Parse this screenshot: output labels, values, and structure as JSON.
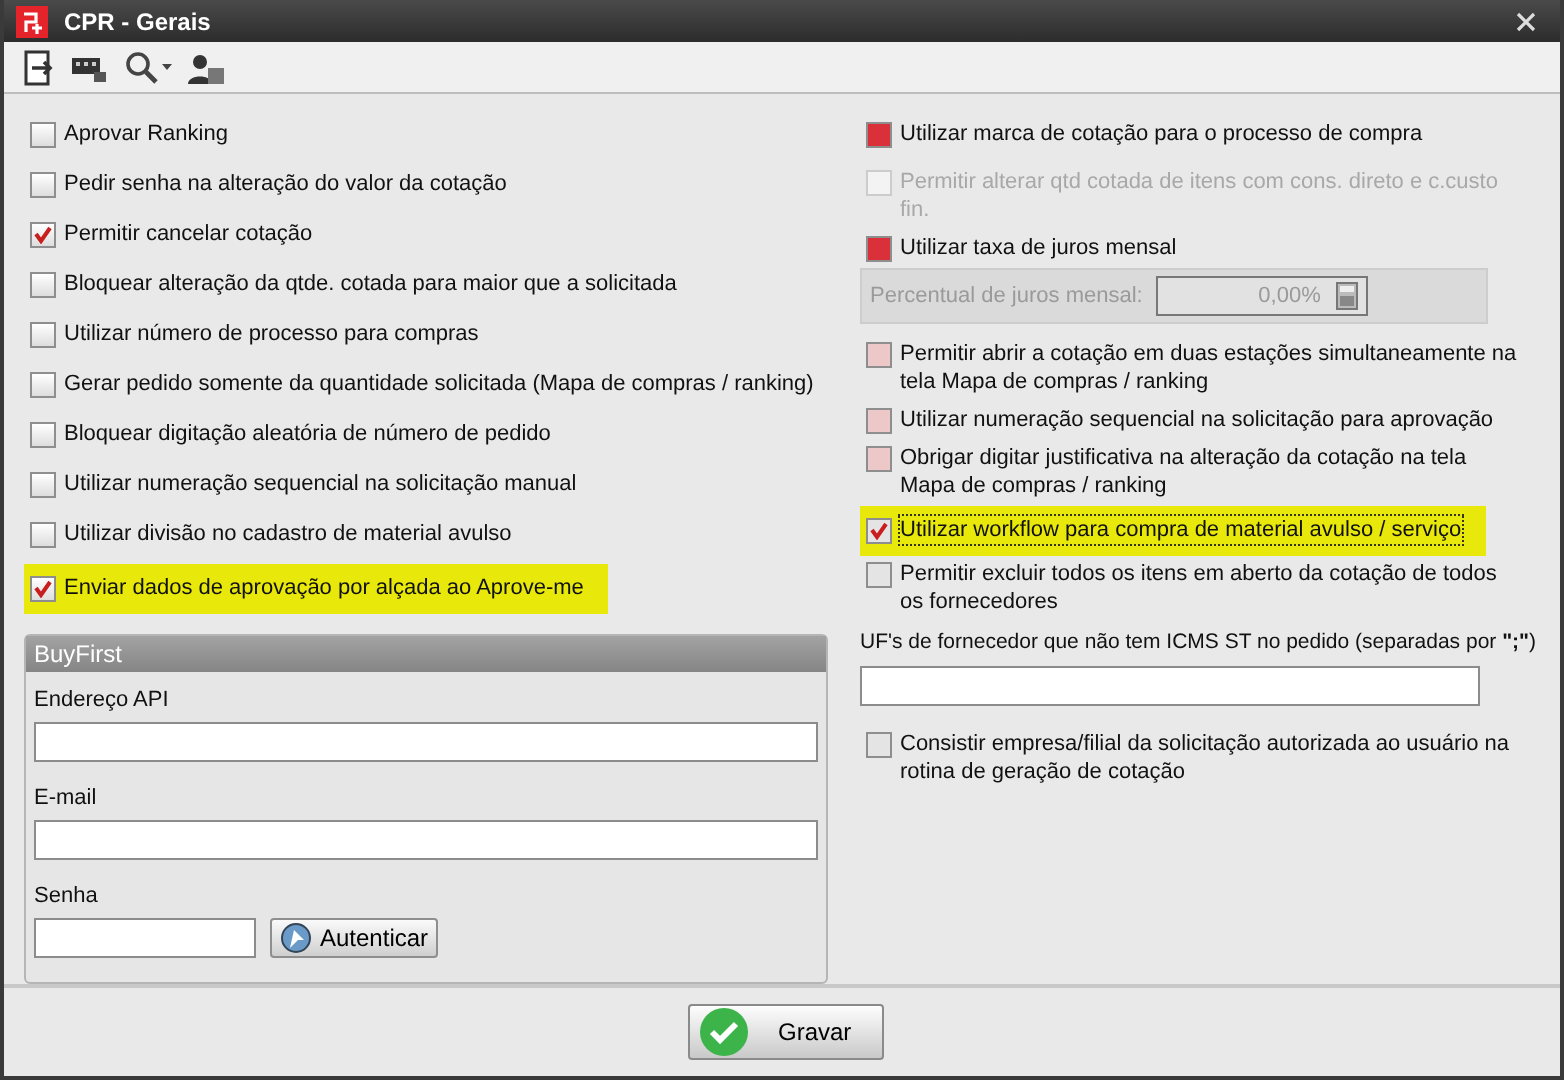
{
  "window": {
    "title": "CPR - Gerais"
  },
  "left_options": [
    {
      "label": "Aprovar Ranking",
      "checked": false,
      "highlighted": false
    },
    {
      "label": "Pedir senha na alteração do valor da cotação",
      "checked": false,
      "highlighted": false
    },
    {
      "label": "Permitir cancelar cotação",
      "checked": true,
      "highlighted": false
    },
    {
      "label": "Bloquear alteração da qtde. cotada para maior que a  solicitada",
      "checked": false,
      "highlighted": false
    },
    {
      "label": "Utilizar número de processo para compras",
      "checked": false,
      "highlighted": false
    },
    {
      "label": "Gerar pedido somente da quantidade solicitada (Mapa de compras / ranking)",
      "checked": false,
      "highlighted": false
    },
    {
      "label": "Bloquear digitação aleatória de número de pedido",
      "checked": false,
      "highlighted": false
    },
    {
      "label": "Utilizar numeração sequencial na solicitação manual",
      "checked": false,
      "highlighted": false
    },
    {
      "label": "Utilizar divisão no cadastro de material avulso",
      "checked": false,
      "highlighted": false
    },
    {
      "label": "Enviar dados de aprovação por alçada ao Aprove-me",
      "checked": true,
      "highlighted": true
    }
  ],
  "buyfirst": {
    "title": "BuyFirst",
    "fields": [
      {
        "label": "Endereço API"
      },
      {
        "label": "E-mail"
      }
    ],
    "password_label": "Senha",
    "auth_button": "Autenticar"
  },
  "right_options": [
    {
      "kind": "checkbox",
      "label": "Utilizar marca de cotação  para o processo de compra",
      "checked": false,
      "color": "#d9303a",
      "disabled": false,
      "highlighted": false
    },
    {
      "kind": "checkbox",
      "label": "Permitir alterar qtd cotada de itens com cons. direto e c.custo fin.",
      "checked": false,
      "color": "#f3f3f3",
      "disabled": true,
      "highlighted": false
    },
    {
      "kind": "checkbox",
      "label": "Utilizar taxa de juros mensal",
      "checked": false,
      "color": "#d9303a",
      "disabled": false,
      "highlighted": false,
      "subfield": {
        "label": "Percentual de juros mensal:",
        "value": "0,00%",
        "disabled": true
      }
    },
    {
      "kind": "checkbox",
      "label": "Permitir abrir a cotação em duas estações simultaneamente na tela Mapa de compras / ranking",
      "checked": false,
      "color": "#ecc8c8",
      "disabled": false,
      "highlighted": false
    },
    {
      "kind": "checkbox",
      "label": "Utilizar numeração sequencial na solicitação para aprovação",
      "checked": false,
      "color": "#ecc8c8",
      "disabled": false,
      "highlighted": false
    },
    {
      "kind": "checkbox",
      "label": "Obrigar digitar justificativa na alteração da cotação na tela Mapa de compras / ranking",
      "checked": false,
      "color": "#ecc8c8",
      "disabled": false,
      "highlighted": false
    },
    {
      "kind": "checkbox",
      "label": "Utilizar workflow para compra de material avulso / serviço",
      "checked": true,
      "color": "#e4e4e4",
      "disabled": false,
      "highlighted": true
    },
    {
      "kind": "checkbox",
      "label": "Permitir excluir todos os itens em aberto da cotação de todos os fornecedores",
      "checked": false,
      "color": "#e4e4e4",
      "disabled": false,
      "highlighted": false
    },
    {
      "kind": "text_field",
      "label": "UF's de fornecedor que não tem ICMS ST no pedido (separadas por **\";\"**)"
    },
    {
      "kind": "checkbox",
      "label": "Consistir empresa/filial da solicitação autorizada ao usuário na rotina de geração de cotação",
      "checked": false,
      "color": "#e4e4e4",
      "disabled": false,
      "highlighted": false
    }
  ],
  "footer": {
    "save_button": "Gravar"
  }
}
